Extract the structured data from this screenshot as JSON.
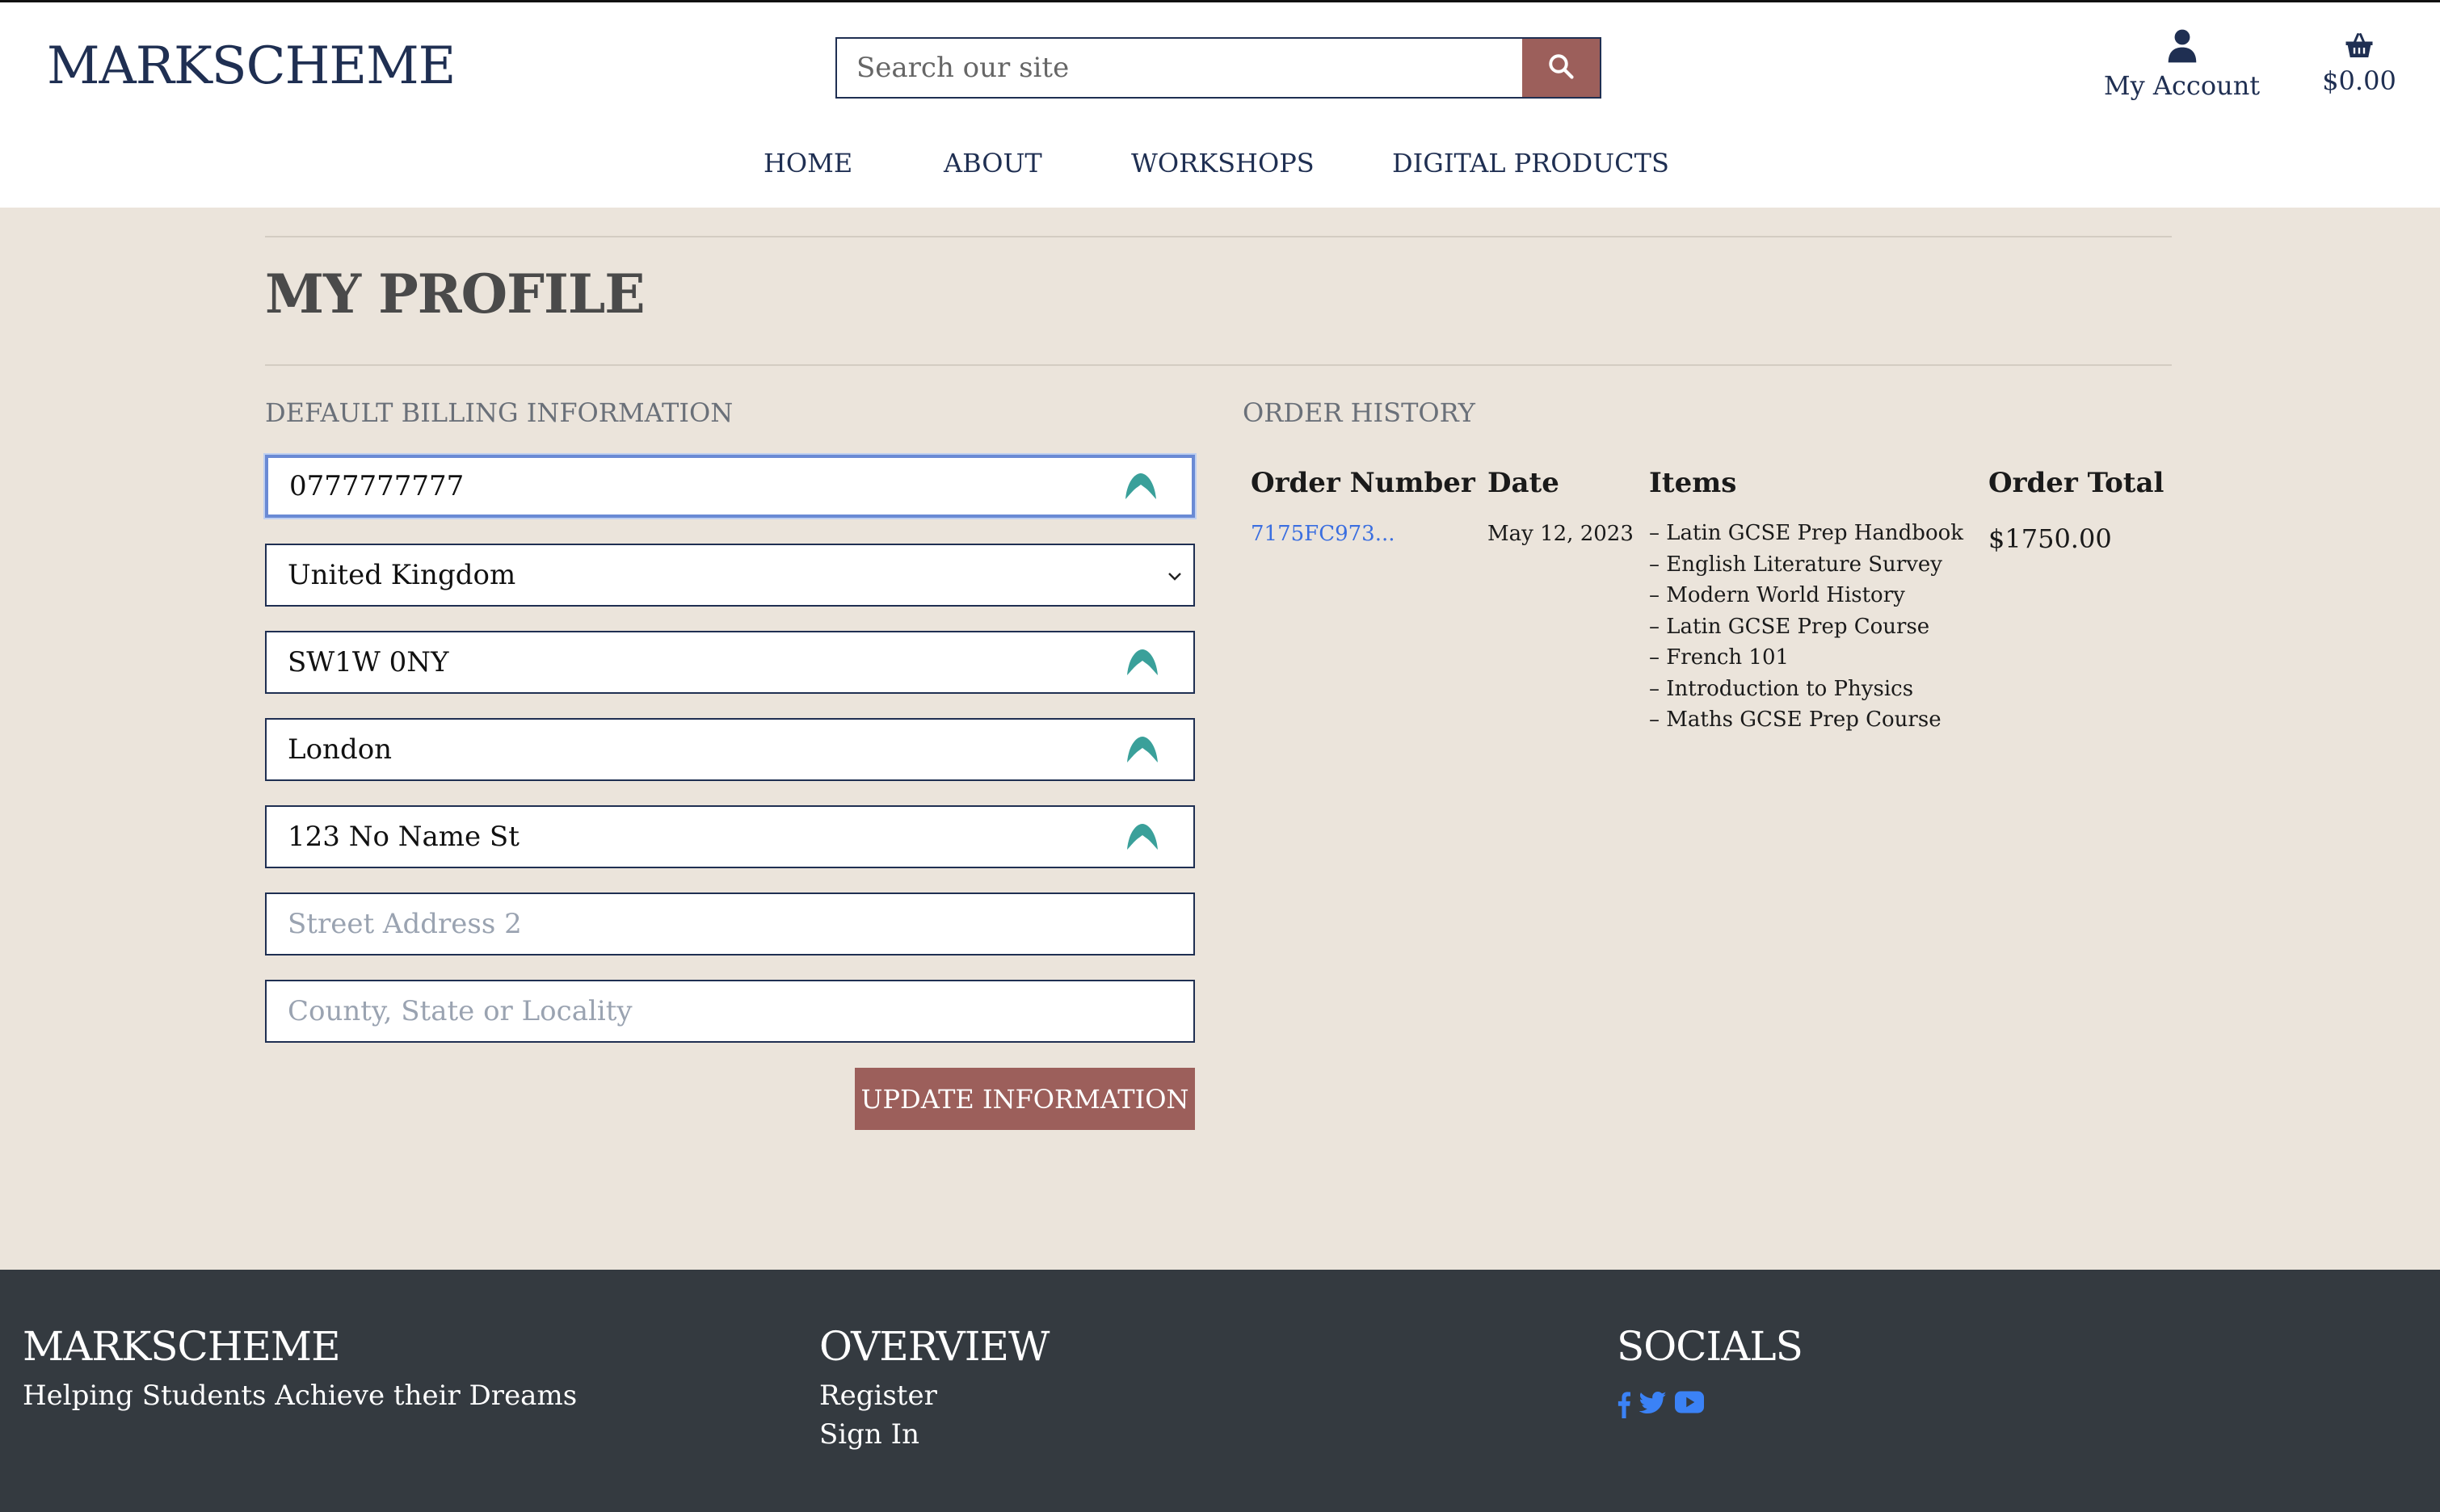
{
  "header": {
    "logo": "MARKSCHEME",
    "search_placeholder": "Search our site",
    "account_label": "My Account",
    "cart_total": "$0.00"
  },
  "nav": {
    "items": [
      {
        "label": "HOME"
      },
      {
        "label": "ABOUT"
      },
      {
        "label": "WORKSHOPS"
      },
      {
        "label": "DIGITAL PRODUCTS"
      }
    ]
  },
  "profile": {
    "title": "MY PROFILE",
    "billing_label": "DEFAULT BILLING INFORMATION",
    "fields": {
      "phone": "0777777777",
      "country": "United Kingdom",
      "postcode": "SW1W 0NY",
      "town": "London",
      "street1": "123 No Name St",
      "street2_placeholder": "Street Address 2",
      "county_placeholder": "County, State or Locality"
    },
    "update_label": "UPDATE INFORMATION"
  },
  "orders": {
    "label": "ORDER HISTORY",
    "headers": {
      "number": "Order Number",
      "date": "Date",
      "items": "Items",
      "total": "Order Total"
    },
    "rows": [
      {
        "number": "7175FC973...",
        "date": "May 12, 2023",
        "items": [
          "– Latin GCSE Prep Handbook",
          "– English Literature Survey",
          "– Modern World History",
          "– Latin GCSE Prep Course",
          "– French 101",
          "– Introduction to Physics",
          "– Maths GCSE Prep Course"
        ],
        "total": "$1750.00"
      }
    ]
  },
  "footer": {
    "brand_title": "MARKSCHEME",
    "tagline": "Helping Students Achieve their Dreams",
    "overview_title": "OVERVIEW",
    "register_label": "Register",
    "signin_label": "Sign In",
    "socials_title": "SOCIALS",
    "social_icons": [
      "facebook-icon",
      "twitter-icon",
      "youtube-icon"
    ]
  },
  "colors": {
    "brand_navy": "#1f2f52",
    "accent": "#9c5f5b",
    "page_bg": "#ebe4db",
    "footer_bg": "#343a40",
    "link_blue": "#3a6ee0",
    "autofill_teal": "#3aa09a"
  }
}
